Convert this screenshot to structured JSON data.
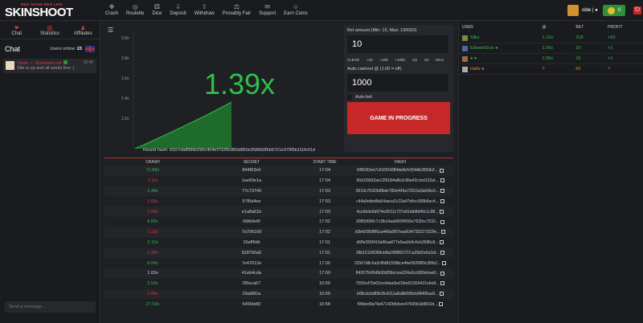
{
  "header": {
    "tagline": "RED SKINS RED LIFE",
    "logo": "SKINSHOOT",
    "nav": [
      {
        "label": "Crash",
        "icon": "crosshair-icon",
        "glyph": "✥"
      },
      {
        "label": "Roulette",
        "icon": "roulette-icon",
        "glyph": "◎"
      },
      {
        "label": "Dice",
        "icon": "dice-icon",
        "glyph": "⚅"
      },
      {
        "label": "Deposit",
        "icon": "deposit-icon",
        "glyph": "⇩"
      },
      {
        "label": "Withdraw",
        "icon": "withdraw-icon",
        "glyph": "⇧"
      },
      {
        "label": "Provably Fair",
        "icon": "balance-scale-icon",
        "glyph": "⚖"
      },
      {
        "label": "Support",
        "icon": "support-icon",
        "glyph": "✉"
      },
      {
        "label": "Earn Coins",
        "icon": "earn-coins-icon",
        "glyph": "☺"
      }
    ],
    "username": "olde | ●",
    "balance": "0"
  },
  "sidebar": {
    "tabs": [
      {
        "label": "Chat",
        "icon": "chat-icon",
        "glyph": "❤"
      },
      {
        "label": "Statistics",
        "icon": "statistics-icon",
        "glyph": "▤"
      },
      {
        "label": "Affiliates",
        "icon": "affiliates-icon",
        "glyph": "♟"
      }
    ],
    "chat_title": "Chat",
    "online_label": "Users online:",
    "online_count": "23",
    "messages": [
      {
        "author": "Olsen ☆ Skinshoot.net",
        "time": "15:40",
        "text": "Site is up and all works fine :)"
      }
    ],
    "send_placeholder": "Send a message..."
  },
  "graph": {
    "multiplier": "1.39x",
    "y_ticks": [
      "2.0x",
      "1.8x",
      "1.6x",
      "1.4x",
      "1.2x"
    ],
    "round_hash": "Round hash: d1b7cbdf998c090c404ef792f6c860d850c958660f5b6721e379f5b111fe91d"
  },
  "controls": {
    "bet_label": "Bet amount (Min: 10, Max: 100000)",
    "bet_value": "10",
    "quick": [
      "CLEAR",
      "+10",
      "+100",
      "+1000",
      "1/2",
      "X2",
      "MAX"
    ],
    "cashout_label": "Auto cashout @ (1.00 = off)",
    "cashout_value": "1000",
    "autobet_label": "Auto-bet",
    "game_button": "GAME IN PROGRESS"
  },
  "history": {
    "headers": {
      "crash": "CRASH",
      "secret": "SECRET",
      "start": "START TIME",
      "hash": "HASH"
    },
    "rows": [
      {
        "crash": "71.89x",
        "c": "green",
        "secret": "844f03e0",
        "start": "17:04",
        "hash": "84f03f2ee7c61f204384de8cfc554db3559b2..."
      },
      {
        "crash": "1.11x",
        "c": "red",
        "secret": "1ae50e1a",
        "start": "17:04",
        "hash": "66d1f3d32ae12f9184a8b3c98a42ccbd132af..."
      },
      {
        "crash": "2.44x",
        "c": "green",
        "secret": "77c73740",
        "start": "17:03",
        "hash": "0519c70323d8bdc782e445a72013a3a60bc6..."
      },
      {
        "crash": "1.02x",
        "c": "red",
        "secret": "57f5d4ee",
        "start": "17:03",
        "hash": "c44a9ebbd8a54aeca2c22a47d4cc568b6ec4..."
      },
      {
        "crash": "1.09x",
        "c": "red",
        "secret": "e1a8a61b",
        "start": "17:03",
        "hash": "4ce3b3e6d974e3531c737a91dddfd49c1c98..."
      },
      {
        "crash": "8.82x",
        "c": "green",
        "secret": "fd9b9e6f",
        "start": "17:02",
        "hash": "30850600c7c1fb14aa66f34055e7630cc7032..."
      },
      {
        "crash": "1.11x",
        "c": "red",
        "secret": "7a706169",
        "start": "17:02",
        "hash": "d3b42059f85ca449a3f07eae634733227322fe..."
      },
      {
        "crash": "2.12x",
        "c": "green",
        "secret": "15aff9db",
        "start": "17:01",
        "hash": "d6ffe355f410a96aa677e5aa0e9c6cb2686c8..."
      },
      {
        "crash": "1.30x",
        "c": "red",
        "secret": "628790a5",
        "start": "17:01",
        "hash": "28b1011f8389cb8a1f6f865727ca29d2e6a2af..."
      },
      {
        "crash": "6.04x",
        "c": "green",
        "secret": "7e47612e",
        "start": "17:00",
        "hash": "32567d8c6a3cf8d81558bce4be0920f89c3f0b2..."
      },
      {
        "crash": "1.83x",
        "c": "white",
        "secret": "41eb4cda",
        "start": "17:00",
        "hash": "84267542b8b30d55bccea224a2cd383ebae8..."
      },
      {
        "crash": "2.53x",
        "c": "green",
        "secret": "0f9eca57",
        "start": "16:59",
        "hash": "7560cd75e02ecddaa3ed19ed21556421e6e8..."
      },
      {
        "crash": "1.06x",
        "c": "red",
        "secret": "29a68f1a",
        "start": "16:59",
        "hash": "b08cdcbd89b2fc4311a8a8b999cb98495ac8..."
      },
      {
        "crash": "27.03x",
        "c": "green",
        "secret": "6456bdf2",
        "start": "16:58",
        "hash": "f90ded9a76e67142b5dcee47645b1b8810d..."
      }
    ]
  },
  "players": {
    "headers": {
      "user": "USER",
      "at": "@",
      "bet": "BET",
      "profit": "PROFIT"
    },
    "rows": [
      {
        "user": "Silks",
        "at": "1.16x",
        "bet": "318",
        "profit": "+60",
        "c": "green",
        "av": "#7a8a4a"
      },
      {
        "user": "Edward Eric ●",
        "at": "1.05x",
        "bet": "10",
        "profit": "+1",
        "c": "green",
        "av": "#4a6a9a"
      },
      {
        "user": "● ●",
        "at": "1.05x",
        "bet": "10",
        "profit": "+1",
        "c": "green",
        "av": "#9a6a4a"
      },
      {
        "user": "Hafiz ●",
        "at": "?",
        "bet": "60",
        "profit": "?",
        "c": "orange",
        "av": "#aaaaaa"
      }
    ]
  },
  "colors": {
    "accent": "#c62828",
    "green": "#2fbf4a",
    "red": "#e03b3b",
    "orange": "#e08a2c"
  }
}
